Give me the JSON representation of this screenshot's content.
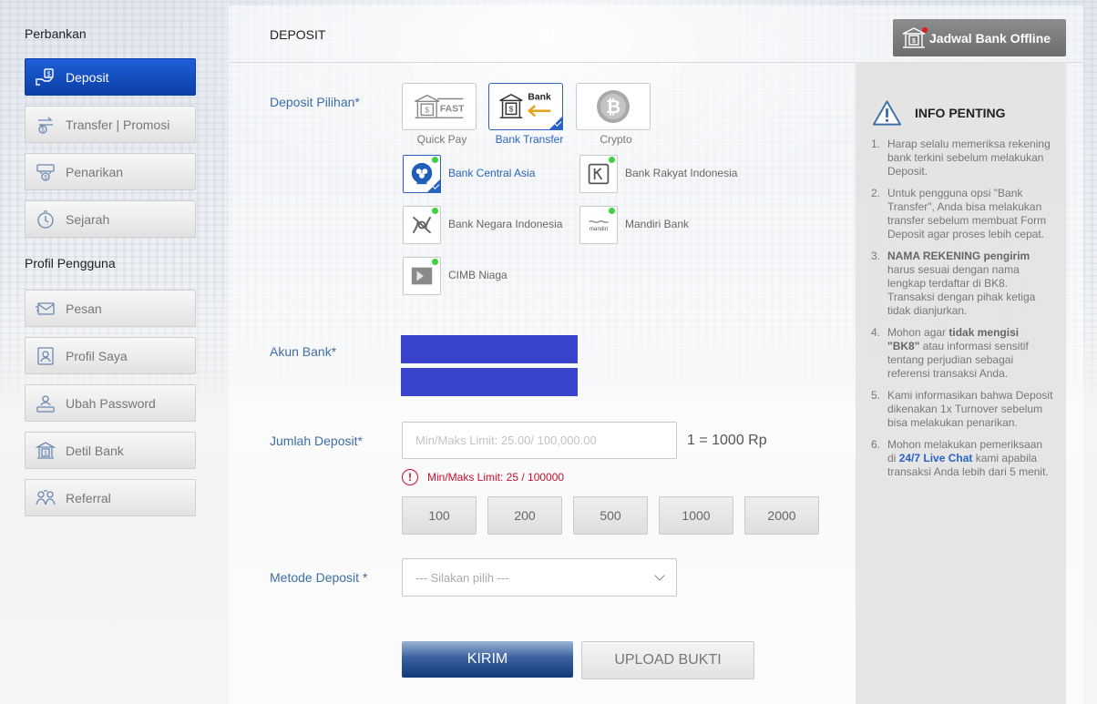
{
  "sidebar": {
    "banking_heading": "Perbankan",
    "banking_items": [
      {
        "label": "Deposit",
        "icon": "deposit-icon",
        "active": true
      },
      {
        "label": "Transfer | Promosi",
        "icon": "transfer-icon",
        "active": false
      },
      {
        "label": "Penarikan",
        "icon": "withdraw-icon",
        "active": false
      },
      {
        "label": "Sejarah",
        "icon": "history-icon",
        "active": false
      }
    ],
    "profile_heading": "Profil Pengguna",
    "profile_items": [
      {
        "label": "Pesan",
        "icon": "envelope-icon"
      },
      {
        "label": "Profil Saya",
        "icon": "user-card-icon"
      },
      {
        "label": "Ubah Password",
        "icon": "password-icon"
      },
      {
        "label": "Detil Bank",
        "icon": "bank-building-icon"
      },
      {
        "label": "Referral",
        "icon": "referral-icon"
      }
    ]
  },
  "header": {
    "title": "DEPOSIT",
    "offline_button": "Jadwal Bank Offline"
  },
  "form": {
    "deposit_option_label": "Deposit Pilihan*",
    "options": [
      {
        "label": "Quick Pay",
        "logo_text": "FAST",
        "selected": false
      },
      {
        "label": "Bank Transfer",
        "logo_text": "Bank",
        "selected": true
      },
      {
        "label": "Crypto",
        "selected": false
      }
    ],
    "banks": [
      {
        "name": "Bank Central Asia",
        "selected": true,
        "online": true
      },
      {
        "name": "Bank Rakyat Indonesia",
        "selected": false,
        "online": true
      },
      {
        "name": "Bank Negara Indonesia",
        "selected": false,
        "online": true
      },
      {
        "name": "Mandiri Bank",
        "logo_text": "mandiri",
        "selected": false,
        "online": true
      },
      {
        "name": "CIMB Niaga",
        "selected": false,
        "online": true
      }
    ],
    "bank_account_label": "Akun Bank*",
    "amount_label": "Jumlah Deposit*",
    "amount_placeholder": "Min/Maks Limit: 25.00/ 100,000.00",
    "rate_text": "1 = 1000 Rp",
    "error_icon": "!",
    "error_text": "Min/Maks Limit: 25 / 100000",
    "quick_amounts": [
      "100",
      "200",
      "500",
      "1000",
      "2000"
    ],
    "method_label": "Metode Deposit *",
    "method_placeholder": "--- Silakan pilih ---",
    "submit_label": "KIRIM",
    "upload_label": "UPLOAD BUKTI"
  },
  "info": {
    "title": "INFO PENTING",
    "items": [
      {
        "num": "1.",
        "parts": [
          {
            "t": "Harap selalu memeriksa rekening bank terkini sebelum melakukan Deposit."
          }
        ]
      },
      {
        "num": "2.",
        "parts": [
          {
            "t": "Untuk pengguna opsi \"Bank Transfer\", Anda bisa melakukan transfer sebelum membuat Form Deposit agar proses lebih cepat."
          }
        ]
      },
      {
        "num": "3.",
        "parts": [
          {
            "t": "NAMA REKENING pengirim",
            "b": true
          },
          {
            "t": " harus sesuai dengan nama lengkap terdaftar di BK8. Transaksi dengan pihak ketiga tidak dianjurkan."
          }
        ]
      },
      {
        "num": "4.",
        "parts": [
          {
            "t": "Mohon agar "
          },
          {
            "t": "tidak mengisi \"BK8\"",
            "b": true
          },
          {
            "t": " atau informasi sensitif tentang perjudian sebagai referensi transaksi Anda."
          }
        ]
      },
      {
        "num": "5.",
        "parts": [
          {
            "t": "Kami informasikan bahwa Deposit dikenakan 1x Turnover sebelum bisa melakukan penarikan."
          }
        ]
      },
      {
        "num": "6.",
        "parts": [
          {
            "t": "Mohon melakukan pemeriksaan di "
          },
          {
            "t": "24/7 Live Chat",
            "link": true
          },
          {
            "t": " kami apabila transaksi Anda lebih dari 5 menit."
          }
        ]
      }
    ]
  }
}
